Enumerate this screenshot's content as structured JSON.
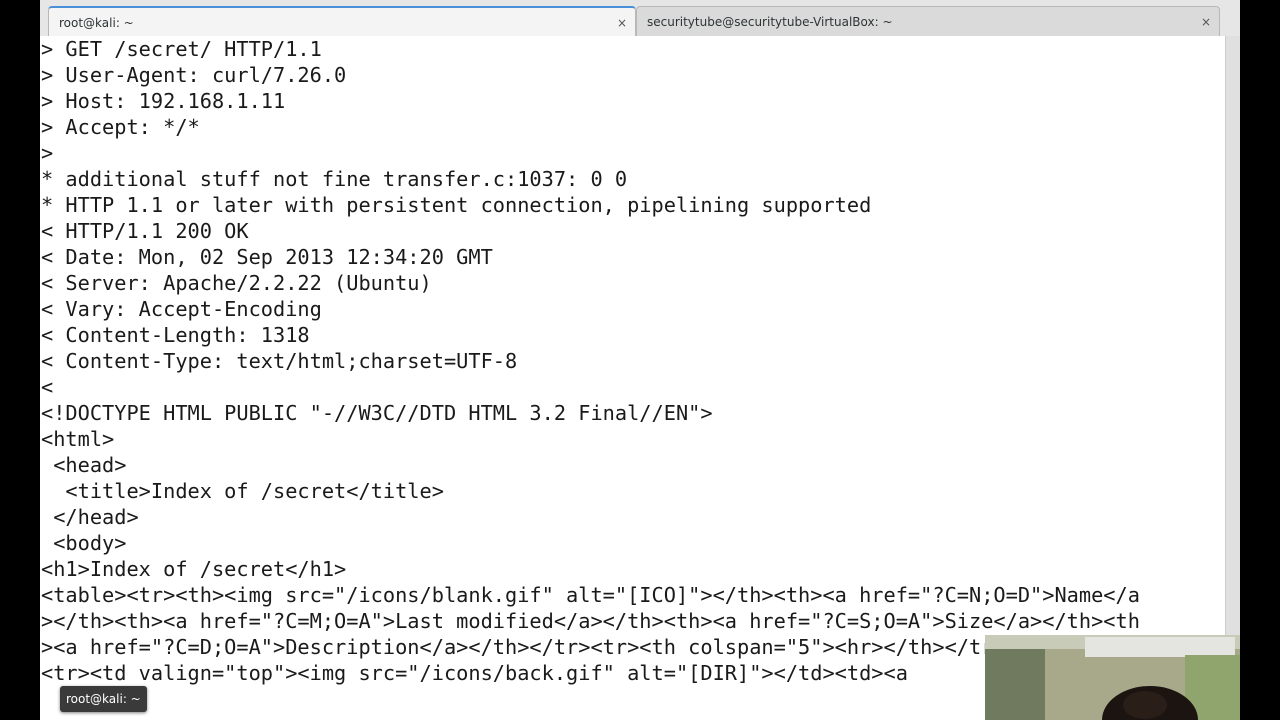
{
  "tabs": [
    {
      "label": "root@kali: ~",
      "close_icon": "×",
      "active": true
    },
    {
      "label": "securitytube@securitytube-VirtualBox: ~",
      "close_icon": "×",
      "active": false
    }
  ],
  "terminal_lines": [
    "> GET /secret/ HTTP/1.1",
    "> User-Agent: curl/7.26.0",
    "> Host: 192.168.1.11",
    "> Accept: */*",
    ">",
    "* additional stuff not fine transfer.c:1037: 0 0",
    "* HTTP 1.1 or later with persistent connection, pipelining supported",
    "< HTTP/1.1 200 OK",
    "< Date: Mon, 02 Sep 2013 12:34:20 GMT",
    "< Server: Apache/2.2.22 (Ubuntu)",
    "< Vary: Accept-Encoding",
    "< Content-Length: 1318",
    "< Content-Type: text/html;charset=UTF-8",
    "<",
    "<!DOCTYPE HTML PUBLIC \"-//W3C//DTD HTML 3.2 Final//EN\">",
    "<html>",
    " <head>",
    "  <title>Index of /secret</title>",
    " </head>",
    " <body>",
    "<h1>Index of /secret</h1>",
    "<table><tr><th><img src=\"/icons/blank.gif\" alt=\"[ICO]\"></th><th><a href=\"?C=N;O=D\">Name</a",
    "></th><th><a href=\"?C=M;O=A\">Last modified</a></th><th><a href=\"?C=S;O=A\">Size</a></th><th",
    "><a href=\"?C=D;O=A\">Description</a></th></tr><tr><th colspan=\"5\"><hr></th></tr>",
    "<tr><td valign=\"top\"><img src=\"/icons/back.gif\" alt=\"[DIR]\"></td><td><a"
  ],
  "tooltip": "root@kali: ~"
}
